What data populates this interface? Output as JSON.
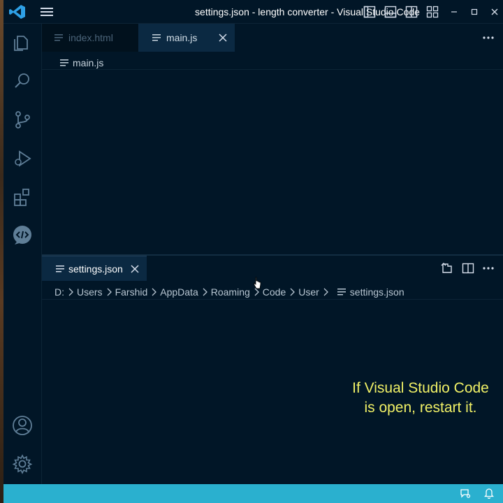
{
  "window": {
    "title": "settings.json - length converter - Visual Studio Code"
  },
  "titlebar_icons": [
    "vscode-logo-icon",
    "menu-icon",
    "toggle-primary-sidebar-icon",
    "toggle-panel-icon",
    "toggle-secondary-sidebar-icon",
    "customize-layout-icon",
    "minimize-icon",
    "maximize-icon",
    "close-window-icon"
  ],
  "activity_bar": {
    "items": [
      {
        "name": "explorer-icon"
      },
      {
        "name": "search-icon"
      },
      {
        "name": "source-control-icon"
      },
      {
        "name": "run-debug-icon"
      },
      {
        "name": "extensions-icon"
      },
      {
        "name": "live-preview-icon"
      }
    ],
    "bottom_items": [
      {
        "name": "accounts-icon"
      },
      {
        "name": "manage-gear-icon"
      }
    ]
  },
  "top_group": {
    "tabs": [
      {
        "label": "index.html",
        "active": false
      },
      {
        "label": "main.js",
        "active": true
      }
    ],
    "breadcrumb": "main.js"
  },
  "bottom_group": {
    "tab": {
      "label": "settings.json"
    },
    "breadcrumb": [
      "D:",
      "Users",
      "Farshid",
      "AppData",
      "Roaming",
      "Code",
      "User",
      "settings.json"
    ],
    "caption_line1": "If Visual Studio Code",
    "caption_line2": "is open, restart it."
  },
  "colors": {
    "background": "#011627",
    "active_tab": "#0b2942",
    "status_bar": "#2ab0cf",
    "caption": "#f0f066"
  }
}
